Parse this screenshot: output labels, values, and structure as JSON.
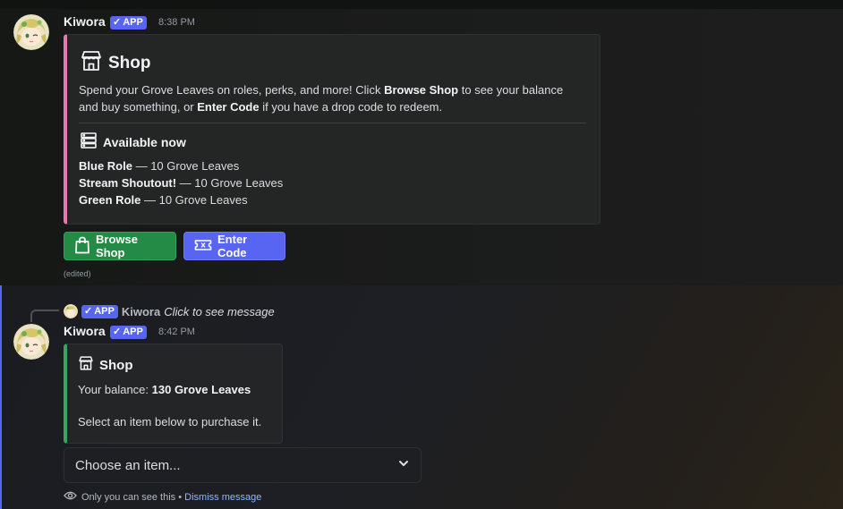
{
  "message1": {
    "author": "Kiwora",
    "badge": "APP",
    "timestamp": "8:38 PM",
    "embed": {
      "accent_color": "#e879b0",
      "title": "Shop",
      "title_icon": "storefront-icon",
      "desc_p1": "Spend your Grove Leaves on roles, perks, and more! Click ",
      "desc_b1": "Browse Shop",
      "desc_p2": " to see your balance",
      "desc_line2_p1": "and buy something, or ",
      "desc_b2": "Enter Code",
      "desc_p3": " if you have a drop code to redeem.",
      "section_title": "Available now",
      "section_icon": "list-icon",
      "items": [
        {
          "name": "Blue Role",
          "price": " — 10 Grove Leaves"
        },
        {
          "name": "Stream Shoutout!",
          "price": " — 10 Grove Leaves"
        },
        {
          "name": "Green Role",
          "price": " — 10 Grove Leaves"
        }
      ]
    },
    "buttons": [
      {
        "label": "Browse Shop",
        "icon": "shopping-bag-icon",
        "color": "#238b45"
      },
      {
        "label": "Enter Code",
        "icon": "ticket-icon",
        "color": "#5865f2"
      }
    ],
    "edited": "(edited)"
  },
  "message2": {
    "reply": {
      "badge": "APP",
      "author": "Kiwora",
      "text": "Click to see message"
    },
    "author": "Kiwora",
    "badge": "APP",
    "timestamp": "8:42 PM",
    "embed": {
      "accent_color": "#3ba55d",
      "title": "Shop",
      "title_icon": "storefront-icon",
      "balance_label": "Your balance: ",
      "balance_value": "130 Grove Leaves",
      "instruction": "Select an item below to purchase it."
    },
    "select": {
      "placeholder": "Choose an item...",
      "icon": "chevron-down-icon"
    },
    "ephemeral": {
      "icon": "eye-icon",
      "text": "Only you can see this • ",
      "dismiss": "Dismiss message"
    }
  },
  "colors": {
    "mention_bar": "#5865f2",
    "link": "#8fb8ff"
  }
}
